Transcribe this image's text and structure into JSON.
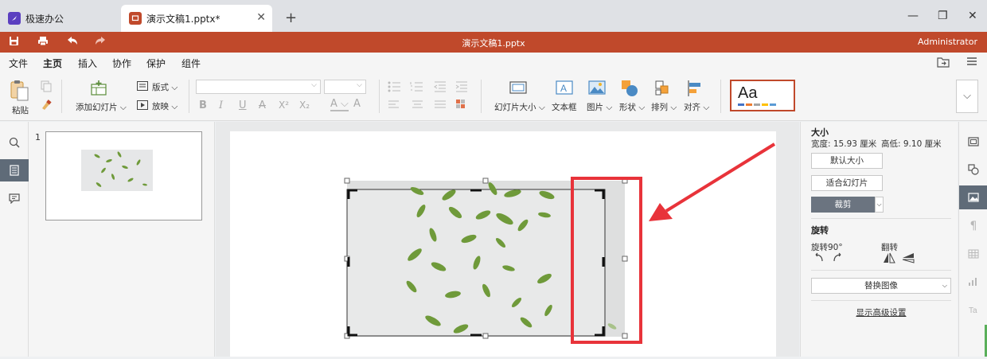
{
  "browser": {
    "tabs": [
      {
        "label": "极速办公",
        "color": "#5b3fc0"
      },
      {
        "label": "演示文稿1.pptx*",
        "color": "#c0492b"
      }
    ],
    "close_glyph": "✕",
    "new_tab_glyph": "+",
    "window_controls": [
      "—",
      "❐",
      "✕"
    ]
  },
  "titlebar": {
    "doc_title": "演示文稿1.pptx",
    "user": "Administrator",
    "quick_icons": [
      "save-icon",
      "print-icon",
      "undo-icon",
      "redo-icon"
    ]
  },
  "menu": {
    "items": [
      "文件",
      "主页",
      "插入",
      "协作",
      "保护",
      "组件"
    ],
    "active": "主页"
  },
  "ribbon": {
    "paste": "粘贴",
    "add_slide": "添加幻灯片",
    "layout": "版式",
    "play": "放映",
    "font_buttons": [
      "B",
      "I",
      "U",
      "A",
      "X²",
      "X₂"
    ],
    "slide_size": "幻灯片大小",
    "textbox": "文本框",
    "picture": "图片",
    "shape": "形状",
    "arrange": "排列",
    "align": "对齐",
    "theme_preview": "Aa",
    "theme_colors": [
      "#4472c4",
      "#ed7d31",
      "#a5a5a5",
      "#ffc000",
      "#5b9bd5"
    ]
  },
  "thumbnails": [
    {
      "number": "1"
    }
  ],
  "right_panel": {
    "size_title": "大小",
    "width_label": "宽度: 15.93 厘米",
    "height_label": "高低: 9.10 厘米",
    "default_size": "默认大小",
    "fit_slide": "适合幻灯片",
    "crop": "裁剪",
    "rotate_title": "旋转",
    "rotate90": "旋转90°",
    "flip": "翻转",
    "replace_image": "替换图像",
    "advanced": "显示高级设置"
  },
  "colors": {
    "accent": "#c0492b",
    "annotation_red": "#e8333a",
    "leaf_green": "#6f9a3a"
  }
}
